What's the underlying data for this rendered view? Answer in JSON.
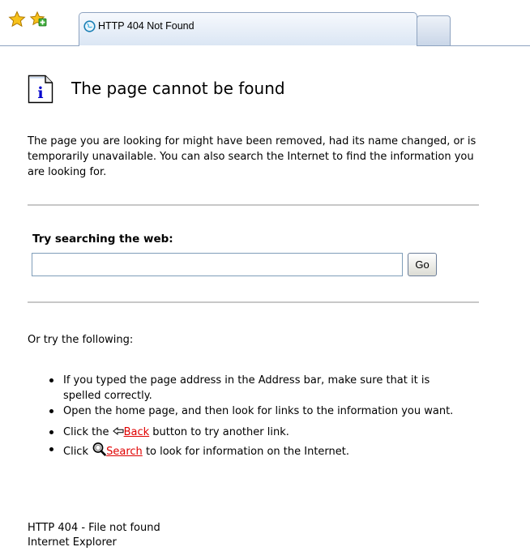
{
  "browser": {
    "tab_title": "HTTP 404 Not Found",
    "icons": {
      "favorites": "favorites-star-icon",
      "add_favorites": "add-to-favorites-icon",
      "tab": "globe-icon"
    }
  },
  "page": {
    "title": "The page cannot be found",
    "intro": "The page you are looking for might have been removed, had its name changed, or is temporarily unavailable. You can also search the Internet to find the information you are looking for.",
    "search": {
      "heading": "Try searching the web:",
      "value": "",
      "button_label": "Go"
    },
    "or_text": "Or try the following:",
    "suggestions": [
      {
        "text": "If you typed the page address in the Address bar, make sure that it is spelled correctly."
      },
      {
        "text": "Open the  home page, and then look for links to the information you want."
      },
      {
        "prefix": "Click the",
        "link": "Back",
        "suffix": "button to try another link.",
        "icon": "back-arrow-icon"
      },
      {
        "prefix": "Click",
        "link": "Search",
        "suffix": "to look for information on the Internet.",
        "icon": "search-magnifier-icon"
      }
    ],
    "footer": {
      "line1": "HTTP 404 - File not found",
      "line2": "Internet Explorer"
    }
  },
  "colors": {
    "link": "#e00000",
    "divider": "#c8c8c8",
    "tab_border": "#8ea3c0"
  }
}
